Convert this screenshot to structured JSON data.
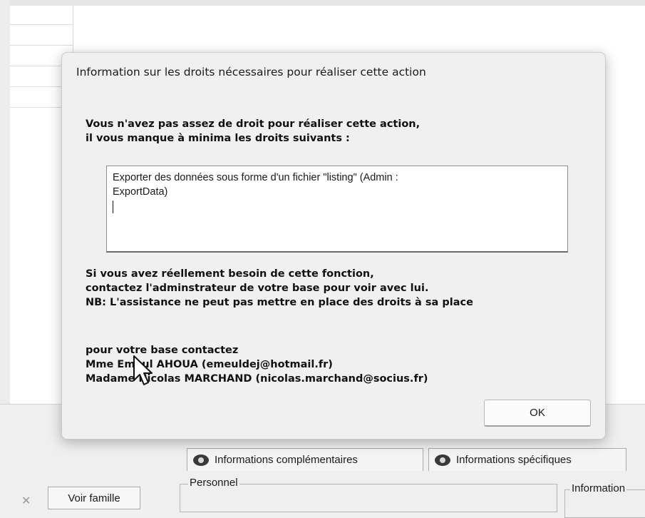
{
  "dialog": {
    "title": "Information sur les droits nécessaires pour réaliser cette action",
    "message_line1": "Vous n'avez pas assez de droit pour réaliser cette action,",
    "message_line2": "il vous manque à minima les droits suivants :",
    "rights_text_line1": "Exporter des données sous forme d'un fichier \"listing\" (Admin :",
    "rights_text_line2": "ExportData)",
    "contact_line1": "Si vous avez réellement besoin de cette fonction,",
    "contact_line2": "contactez l'adminstrateur de votre base pour voir avec lui.",
    "contact_line3": "NB: L'assistance ne peut pas mettre en place des droits à sa place",
    "admins_heading": "pour votre base contactez",
    "admin1": "Mme Emeul AHOUA (emeuldej@hotmail.fr)",
    "admin2": "Madame Nicolas MARCHAND (nicolas.marchand@socius.fr)",
    "ok_label": "OK"
  },
  "background": {
    "tabs": [
      {
        "label": "Informations complémentaires",
        "icon": "eye-icon"
      },
      {
        "label": "Informations spécifiques",
        "icon": "eye-icon"
      }
    ],
    "voir_famille_label": "Voir famille",
    "group_personnel_label": "Personnel",
    "group_information_label": "Information"
  }
}
